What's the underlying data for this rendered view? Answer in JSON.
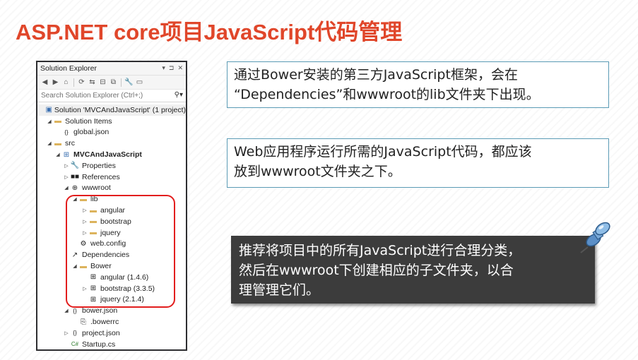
{
  "slide": {
    "title": "ASP.NET core项目JavaScript代码管理"
  },
  "solution_explorer": {
    "title": "Solution Explorer",
    "title_controls": [
      "▾",
      "⊐",
      "✕"
    ],
    "search_placeholder": "Search Solution Explorer (Ctrl+;)",
    "tree": [
      {
        "label": "Solution 'MVCAndJavaScript' (1 project)",
        "icon": "solution-icon",
        "glyph": "▣",
        "expander": "",
        "depth": 0
      },
      {
        "label": "Solution Items",
        "icon": "folder-icon",
        "glyph": "▬",
        "expander": "◢",
        "depth": 1
      },
      {
        "label": "global.json",
        "icon": "json-file-icon",
        "glyph": "{}",
        "expander": "",
        "depth": 2
      },
      {
        "label": "src",
        "icon": "folder-icon",
        "glyph": "▬",
        "expander": "◢",
        "depth": 1
      },
      {
        "label": "MVCAndJavaScript",
        "icon": "web-project-icon",
        "glyph": "⊞",
        "expander": "◢",
        "depth": 2,
        "bold": true
      },
      {
        "label": "Properties",
        "icon": "wrench-icon",
        "glyph": "🔧",
        "expander": "▷",
        "depth": 3
      },
      {
        "label": "References",
        "icon": "references-icon",
        "glyph": "■■",
        "expander": "▷",
        "depth": 3
      },
      {
        "label": "wwwroot",
        "icon": "globe-icon",
        "glyph": "⊕",
        "expander": "◢",
        "depth": 3
      },
      {
        "label": "lib",
        "icon": "folder-icon",
        "glyph": "▬",
        "expander": "◢",
        "depth": 4
      },
      {
        "label": "angular",
        "icon": "folder-icon",
        "glyph": "▬",
        "expander": "▷",
        "depth": 5
      },
      {
        "label": "bootstrap",
        "icon": "folder-icon",
        "glyph": "▬",
        "expander": "▷",
        "depth": 5
      },
      {
        "label": "jquery",
        "icon": "folder-icon",
        "glyph": "▬",
        "expander": "▷",
        "depth": 5
      },
      {
        "label": "web.config",
        "icon": "config-file-icon",
        "glyph": "⚙",
        "expander": "",
        "depth": 4
      },
      {
        "label": "Dependencies",
        "icon": "dependencies-icon",
        "glyph": "↗",
        "expander": "",
        "depth": 3
      },
      {
        "label": "Bower",
        "icon": "folder-icon",
        "glyph": "▬",
        "expander": "◢",
        "depth": 4
      },
      {
        "label": "angular (1.4.6)",
        "icon": "package-icon",
        "glyph": "⊞",
        "expander": "",
        "depth": 5
      },
      {
        "label": "bootstrap (3.3.5)",
        "icon": "package-icon",
        "glyph": "⊞",
        "expander": "▷",
        "depth": 5
      },
      {
        "label": "jquery (2.1.4)",
        "icon": "package-icon",
        "glyph": "⊞",
        "expander": "",
        "depth": 5
      },
      {
        "label": "bower.json",
        "icon": "json-file-icon",
        "glyph": "{}",
        "expander": "◢",
        "depth": 3
      },
      {
        "label": ".bowerrc",
        "icon": "file-icon",
        "glyph": "⎘",
        "expander": "",
        "depth": 4
      },
      {
        "label": "project.json",
        "icon": "json-file-icon",
        "glyph": "{}",
        "expander": "▷",
        "depth": 3
      },
      {
        "label": "Startup.cs",
        "icon": "csharp-file-icon",
        "glyph": "C#",
        "expander": "",
        "depth": 3
      }
    ]
  },
  "callouts": {
    "box1_line1": "通过Bower安装的第三方JavaScript框架，会在",
    "box1_line2": "“Dependencies”和wwwroot的lib文件夹下出现。",
    "box2_line1": "Web应用程序运行所需的JavaScript代码，都应该",
    "box2_line2": "放到wwwroot文件夹之下。",
    "box3_line1": "推荐将项目中的所有JavaScript进行合理分类，",
    "box3_line2": "然后在wwwroot下创建相应的子文件夹，以合",
    "box3_line3": "理管理它们。"
  },
  "colors": {
    "title": "#e0462a",
    "highlight_box": "#e21d1d",
    "callout_border": "#5b9bb5",
    "callout_dark_bg": "#3c3c3c"
  }
}
